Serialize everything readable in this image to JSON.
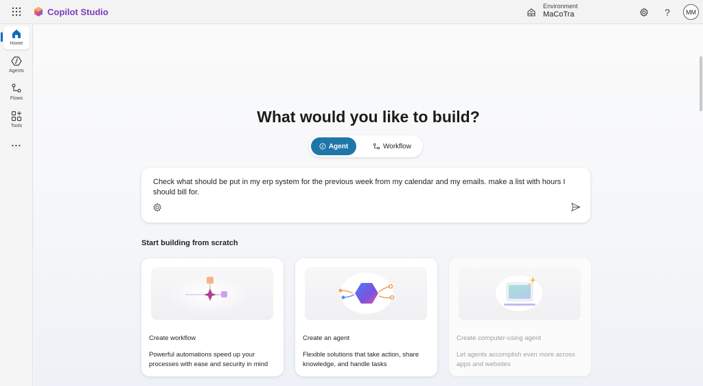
{
  "topbar": {
    "app_title": "Copilot Studio",
    "environment_label": "Environment",
    "environment_value": "MaCoTra",
    "avatar_initials": "MM",
    "help_label": "?"
  },
  "sidebar": {
    "items": [
      {
        "label": "Home",
        "icon": "home-icon",
        "active": true
      },
      {
        "label": "Agents",
        "icon": "agents-icon",
        "active": false
      },
      {
        "label": "Flows",
        "icon": "flows-icon",
        "active": false
      },
      {
        "label": "Tools",
        "icon": "tools-icon",
        "active": false
      }
    ],
    "more_label": "..."
  },
  "main": {
    "headline": "What would you like to build?",
    "modes": [
      {
        "label": "Agent",
        "selected": true
      },
      {
        "label": "Workflow",
        "selected": false
      }
    ],
    "prompt_value": "Check what should be put in my erp system for the previous week from my calendar and my emails. make a list with hours I should bill for.",
    "section_title": "Start building from scratch",
    "cards": [
      {
        "title": "Create workflow",
        "description": "Powerful automations speed up your processes with ease and security in mind",
        "enabled": true
      },
      {
        "title": "Create an agent",
        "description": "Flexible solutions that take action, share knowledge, and handle tasks",
        "enabled": true
      },
      {
        "title": "Create computer-using agent",
        "description": "Let agents accomplish even more across apps and websites",
        "enabled": false
      }
    ]
  },
  "colors": {
    "accent": "#1f76a8",
    "brand_title": "#7b3fb8",
    "nav_indicator": "#0f6cbd"
  }
}
